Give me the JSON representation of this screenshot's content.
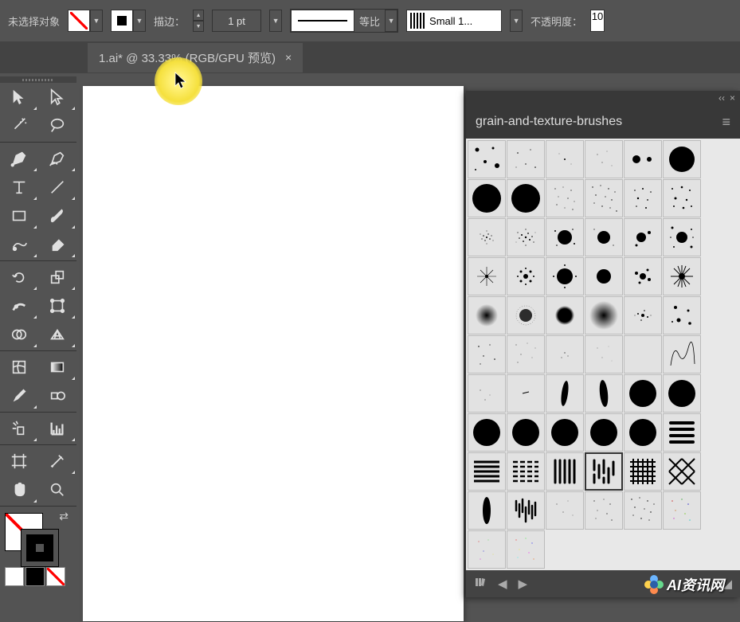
{
  "options": {
    "no_selection_label": "未选择对象",
    "stroke_label": "描边：",
    "stroke_weight": "1 pt",
    "profile_label": "等比",
    "brush_name": "Small 1...",
    "opacity_label": "不透明度：",
    "opacity_value": "10"
  },
  "tab": {
    "title": "1.ai* @ 33.33% (RGB/GPU 预览)",
    "close": "×"
  },
  "panel": {
    "title": "grain-and-texture-brushes",
    "collapse_arrows": "‹‹",
    "close": "×",
    "menu": "≡"
  },
  "watermark": {
    "text": "AI资讯网"
  },
  "footer": {
    "library": "⌂",
    "prev": "◀",
    "next": "▶",
    "resize": "◢"
  }
}
